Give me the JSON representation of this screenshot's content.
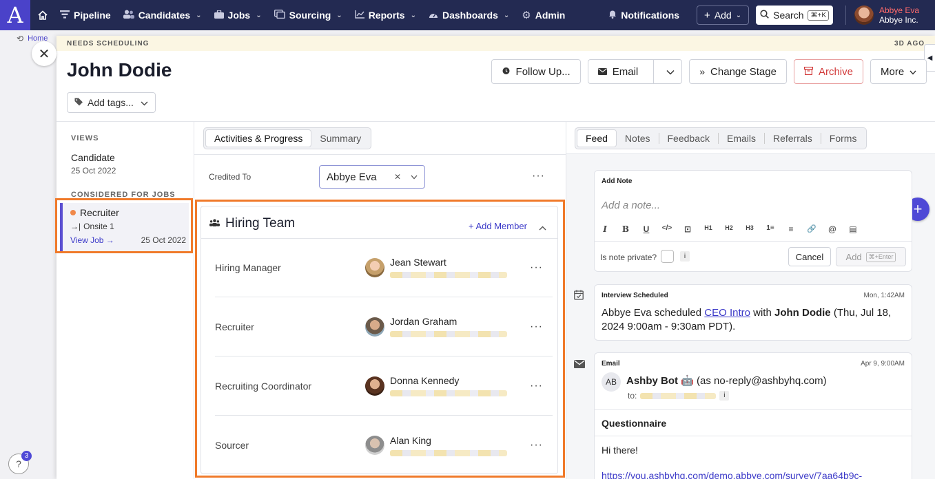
{
  "topnav": {
    "logo": "A",
    "items": [
      {
        "label": "Pipeline",
        "icon": "filter-icon",
        "caret": false
      },
      {
        "label": "Candidates",
        "icon": "people-icon",
        "caret": true
      },
      {
        "label": "Jobs",
        "icon": "briefcase-icon",
        "caret": true
      },
      {
        "label": "Sourcing",
        "icon": "sourcing-icon",
        "caret": true
      },
      {
        "label": "Reports",
        "icon": "chart-icon",
        "caret": true
      },
      {
        "label": "Dashboards",
        "icon": "gauge-icon",
        "caret": true
      },
      {
        "label": "Admin",
        "icon": "gear-icon",
        "caret": false
      }
    ],
    "notifications_label": "Notifications",
    "add_label": "Add",
    "search_label": "Search",
    "search_shortcut": "⌘+K",
    "user_name": "Abbye Eva",
    "user_org": "Abbye Inc."
  },
  "breadcrumb": {
    "label": "Home"
  },
  "banner": {
    "status": "NEEDS SCHEDULING",
    "age": "3D AGO"
  },
  "candidate": {
    "name": "John Dodie"
  },
  "header_buttons": {
    "follow_up": "Follow Up...",
    "email": "Email",
    "change_stage": "Change Stage",
    "archive": "Archive",
    "more": "More"
  },
  "tags": {
    "label": "Add tags..."
  },
  "views": {
    "label": "VIEWS",
    "title": "Candidate",
    "date": "25 Oct 2022"
  },
  "considered": {
    "label": "CONSIDERED FOR JOBS",
    "job_title": "Recruiter",
    "stage": "Onsite 1",
    "view_job": "View Job →",
    "date": "25 Oct 2022"
  },
  "middle": {
    "tabs": [
      "Activities & Progress",
      "Summary"
    ],
    "credited_label": "Credited To",
    "credited_value": "Abbye Eva",
    "hiring_team": {
      "title": "Hiring Team",
      "add_member": "+ Add Member",
      "members": [
        {
          "role": "Hiring Manager",
          "name": "Jean Stewart"
        },
        {
          "role": "Recruiter",
          "name": "Jordan Graham"
        },
        {
          "role": "Recruiting Coordinator",
          "name": "Donna Kennedy"
        },
        {
          "role": "Sourcer",
          "name": "Alan King"
        }
      ]
    }
  },
  "right": {
    "tabs": [
      "Feed",
      "Notes",
      "Feedback",
      "Emails",
      "Referrals",
      "Forms"
    ],
    "note": {
      "heading": "Add Note",
      "placeholder": "Add a note...",
      "toolbar": [
        "I",
        "B",
        "U",
        "</>",
        "⊡",
        "H1",
        "H2",
        "H3",
        "1≡",
        "≡",
        "🔗",
        "@",
        "▤"
      ],
      "private_label": "Is note private?",
      "info": "i",
      "cancel": "Cancel",
      "add": "Add",
      "add_shortcut": "⌘+Enter"
    },
    "interview": {
      "type": "Interview Scheduled",
      "time": "Mon, 1:42AM",
      "actor": "Abbye Eva",
      "verb": " scheduled ",
      "link": "CEO Intro",
      "with": " with ",
      "candidate": "John Dodie",
      "rest": " (Thu, Jul 18, 2024 9:00am - 9:30am PDT)."
    },
    "email": {
      "type": "Email",
      "time": "Apr 9, 9:00AM",
      "avatar": "AB",
      "sender": "Ashby Bot 🤖",
      "sender_addr": " (as no-reply@ashbyhq.com)",
      "to_label": "to:",
      "info": "i",
      "subject": "Questionnaire",
      "body": "Hi there!",
      "link": "https://you.ashbyhq.com/demo.abbye.com/survey/7aa64b9c-"
    }
  },
  "help": {
    "badge": "3",
    "icon": "?"
  }
}
